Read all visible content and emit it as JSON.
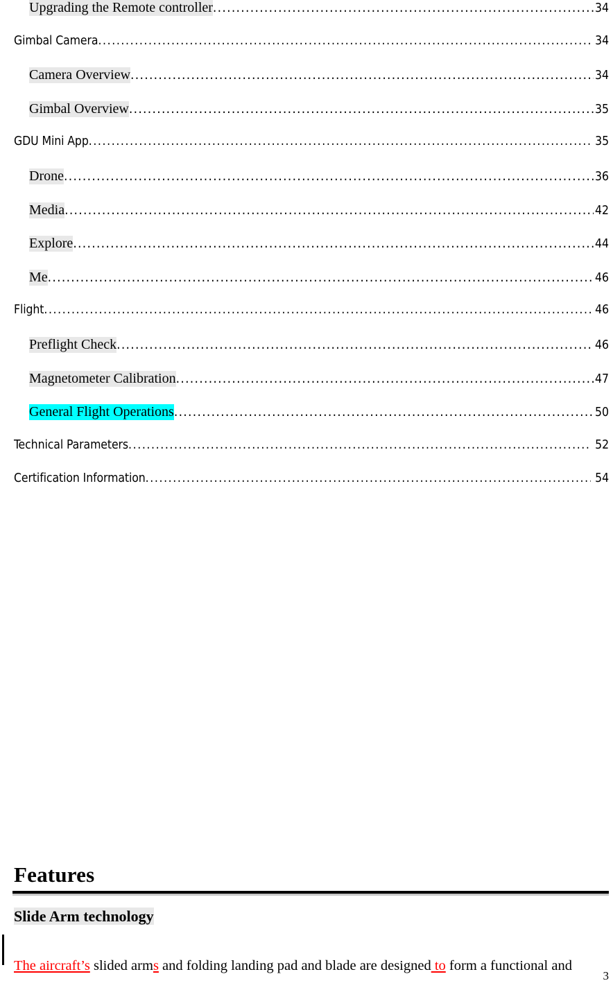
{
  "document": {
    "page_number": "3",
    "colors": {
      "highlight_gray": "#E8E8E8",
      "highlight_cyan": "#00FFFF",
      "insertion_red": "#FF0000",
      "rule_black": "#000000",
      "rule_shadow_gray": "#C8C8C8"
    }
  },
  "toc": {
    "entries": [
      {
        "title": "Upgrading the Remote controller",
        "page": "34",
        "level": 2,
        "highlight": "gray"
      },
      {
        "title": "Gimbal Camera",
        "page": "34",
        "level": 1,
        "highlight": "none"
      },
      {
        "title": "Camera Overview",
        "page": "34",
        "level": 2,
        "highlight": "gray"
      },
      {
        "title": "Gimbal Overview",
        "page": "35",
        "level": 2,
        "highlight": "gray"
      },
      {
        "title": "GDU Mini App",
        "page": "35",
        "level": 1,
        "highlight": "none"
      },
      {
        "title": "Drone",
        "page": "36",
        "level": 2,
        "highlight": "gray"
      },
      {
        "title": "Media",
        "page": "42",
        "level": 2,
        "highlight": "gray"
      },
      {
        "title": "Explore",
        "page": "44",
        "level": 2,
        "highlight": "gray"
      },
      {
        "title": "Me",
        "page": "46",
        "level": 2,
        "highlight": "gray"
      },
      {
        "title": "Flight",
        "page": "46",
        "level": 1,
        "highlight": "none"
      },
      {
        "title": "Preflight Check",
        "page": "46",
        "level": 2,
        "highlight": "gray"
      },
      {
        "title": "Magnetometer Calibration",
        "page": "47",
        "level": 2,
        "highlight": "gray"
      },
      {
        "title": "General Flight Operations",
        "page": "50",
        "level": 2,
        "highlight": "cyan"
      },
      {
        "title": "Technical Parameters",
        "page": "52",
        "level": 1,
        "highlight": "none"
      },
      {
        "title": "Certification Information",
        "page": "54",
        "level": 1,
        "highlight": "none"
      }
    ]
  },
  "features_section": {
    "heading": "Features",
    "subheading": "Slide Arm technology",
    "paragraph": {
      "runs": [
        {
          "text": "The aircraft’s",
          "type": "insertion"
        },
        {
          "text": " slided arm",
          "type": "normal"
        },
        {
          "text": "s",
          "type": "insertion"
        },
        {
          "text": " and folding landing pad and blade are designed",
          "type": "normal"
        },
        {
          "text": " to",
          "type": "insertion"
        },
        {
          "text": " form a functional and",
          "type": "normal"
        }
      ]
    }
  }
}
